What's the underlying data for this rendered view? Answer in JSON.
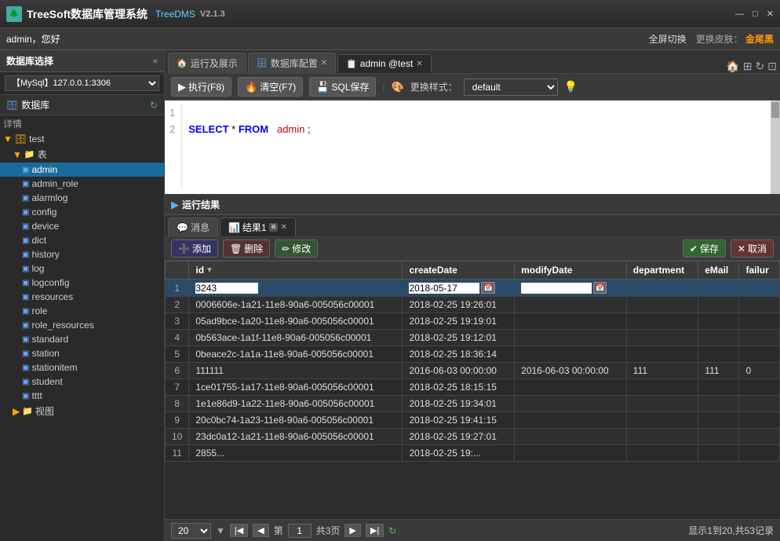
{
  "titleBar": {
    "appName": "TreeSoft数据库管理系统",
    "brandName": "TreeDMS",
    "version": "V2.1.3",
    "minimizeIcon": "—",
    "maximizeIcon": "□",
    "closeIcon": "✕"
  },
  "menuBar": {
    "user": "admin，您好",
    "fullscreen": "全屏切换",
    "changeSkin": "更换皮肤：",
    "skin": "金尾黑"
  },
  "tabs": [
    {
      "icon": "🏠",
      "label": "运行及展示",
      "active": false,
      "closable": false
    },
    {
      "icon": "🗄",
      "label": "数据库配置",
      "active": false,
      "closable": true
    },
    {
      "icon": "📋",
      "label": "admin @test",
      "active": true,
      "closable": true
    }
  ],
  "tabRightBtns": [
    "🏠",
    "⊞",
    "↻",
    "⊡"
  ],
  "toolbar": {
    "execute": "执行(F8)",
    "clear": "清空(F7)",
    "sqlSave": "SQL保存",
    "styleLabel": "更换样式：",
    "styleDefault": "default",
    "hint": "💡"
  },
  "editor": {
    "lines": [
      "1",
      "2"
    ],
    "code": "SELECT * FROM  admin ;"
  },
  "resultsHeader": {
    "title": "运行结果"
  },
  "resultsTabs": [
    {
      "icon": "💬",
      "label": "消息",
      "active": false
    },
    {
      "icon": "📊",
      "label": "结果1",
      "active": true,
      "closable": true
    }
  ],
  "resultsToolbar": {
    "add": "添加",
    "delete": "删除",
    "edit": "修改",
    "save": "保存",
    "cancel": "取消"
  },
  "tableColumns": [
    "id",
    "createDate",
    "modifyDate",
    "department",
    "eMail",
    "failur"
  ],
  "tableRows": [
    {
      "id": "3243",
      "createDate": "2018-05-17",
      "modifyDate": "",
      "department": "",
      "eMail": "",
      "failure": "",
      "editing": true
    },
    {
      "id": "0006606e-1a21-11e8-90a6-005056c00001",
      "createDate": "2018-02-25 19:26:01",
      "modifyDate": "",
      "department": "",
      "eMail": "",
      "failure": ""
    },
    {
      "id": "05ad9bce-1a20-11e8-90a6-005056c00001",
      "createDate": "2018-02-25 19:19:01",
      "modifyDate": "",
      "department": "",
      "eMail": "",
      "failure": ""
    },
    {
      "id": "0b563ace-1a1f-11e8-90a6-005056c00001",
      "createDate": "2018-02-25 19:12:01",
      "modifyDate": "",
      "department": "",
      "eMail": "",
      "failure": ""
    },
    {
      "id": "0beace2c-1a1a-11e8-90a6-005056c00001",
      "createDate": "2018-02-25 18:36:14",
      "modifyDate": "",
      "department": "",
      "eMail": "",
      "failure": ""
    },
    {
      "id": "111111",
      "createDate": "2016-06-03 00:00:00",
      "modifyDate": "2016-06-03 00:00:00",
      "department": "111",
      "eMail": "111",
      "failure": "0"
    },
    {
      "id": "1ce01755-1a17-11e8-90a6-005056c00001",
      "createDate": "2018-02-25 18:15:15",
      "modifyDate": "",
      "department": "",
      "eMail": "",
      "failure": ""
    },
    {
      "id": "1e1e86d9-1a22-11e8-90a6-005056c00001",
      "createDate": "2018-02-25 19:34:01",
      "modifyDate": "",
      "department": "",
      "eMail": "",
      "failure": ""
    },
    {
      "id": "20c0bc74-1a23-11e8-90a6-005056c00001",
      "createDate": "2018-02-25 19:41:15",
      "modifyDate": "",
      "department": "",
      "eMail": "",
      "failure": ""
    },
    {
      "id": "23dc0a12-1a21-11e8-90a6-005056c00001",
      "createDate": "2018-02-25 19:27:01",
      "modifyDate": "",
      "department": "",
      "eMail": "",
      "failure": ""
    },
    {
      "id": "2855...",
      "createDate": "2018-02-25 19:...",
      "modifyDate": "",
      "department": "",
      "eMail": "",
      "failure": ""
    }
  ],
  "pagination": {
    "pageSize": "20",
    "currentPage": "1",
    "totalPages": "共3页",
    "recordInfo": "显示1到20,共53记录"
  },
  "sidebar": {
    "title": "数据库选择",
    "dbConnection": "【MySql】127.0.0.1:3306",
    "sectionLabel": "数据库",
    "treeItems": [
      {
        "label": "test",
        "type": "db",
        "level": 0,
        "expanded": true
      },
      {
        "label": "表",
        "type": "folder",
        "level": 1,
        "expanded": true
      },
      {
        "label": "admin",
        "type": "table",
        "level": 2,
        "active": true
      },
      {
        "label": "admin_role",
        "type": "table",
        "level": 2
      },
      {
        "label": "alarmlog",
        "type": "table",
        "level": 2
      },
      {
        "label": "config",
        "type": "table",
        "level": 2
      },
      {
        "label": "device",
        "type": "table",
        "level": 2
      },
      {
        "label": "dict",
        "type": "table",
        "level": 2
      },
      {
        "label": "history",
        "type": "table",
        "level": 2
      },
      {
        "label": "log",
        "type": "table",
        "level": 2
      },
      {
        "label": "logconfig",
        "type": "table",
        "level": 2
      },
      {
        "label": "resources",
        "type": "table",
        "level": 2
      },
      {
        "label": "role",
        "type": "table",
        "level": 2
      },
      {
        "label": "role_resources",
        "type": "table",
        "level": 2
      },
      {
        "label": "standard",
        "type": "table",
        "level": 2
      },
      {
        "label": "station",
        "type": "table",
        "level": 2
      },
      {
        "label": "stationitem",
        "type": "table",
        "level": 2
      },
      {
        "label": "student",
        "type": "table",
        "level": 2
      },
      {
        "label": "tttt",
        "type": "table",
        "level": 2
      }
    ],
    "viewsLabel": "视图"
  }
}
